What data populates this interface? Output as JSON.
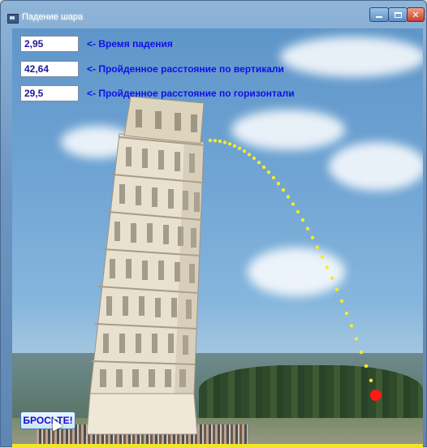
{
  "window": {
    "title": "Падение шара",
    "controls": {
      "minimize": "minimize",
      "maximize": "maximize",
      "close": "close"
    }
  },
  "readouts": [
    {
      "value": "2,95",
      "label": "<- Время падения"
    },
    {
      "value": "42,64",
      "label": "<- Пройденное расстояние по вертикали"
    },
    {
      "value": "29,5",
      "label": "<- Пройденное расстояние по горизонтали"
    }
  ],
  "throw_button": {
    "label": "БРОСЬТЕ!"
  },
  "colors": {
    "trajectory": "#f5ea2a",
    "ball": "#ff1a1a",
    "readout_text": "#1a1a9e",
    "label_text": "#1010e6"
  },
  "icons": {
    "app": "window-app-icon",
    "cursor": "mouse-cursor-icon"
  }
}
